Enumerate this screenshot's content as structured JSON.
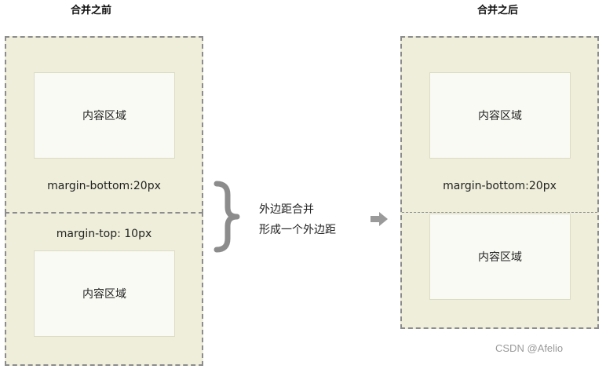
{
  "before": {
    "title": "合并之前",
    "top_content": "内容区域",
    "bottom_margin_label": "margin-bottom:20px",
    "top_margin_label": "margin-top: 10px",
    "bottom_content": "内容区域"
  },
  "middle": {
    "line1": "外边距合并",
    "line2": "形成一个外边距"
  },
  "after": {
    "title": "合并之后",
    "top_content": "内容区域",
    "margin_label": "margin-bottom:20px",
    "bottom_content": "内容区域"
  },
  "watermark": "CSDN @Afelio",
  "colors": {
    "box_fill": "#efeedb",
    "content_fill": "#fafaf5",
    "dashed_border": "#8c8c8c",
    "brace": "#8c8c8c",
    "arrow": "#9a9a9a"
  }
}
